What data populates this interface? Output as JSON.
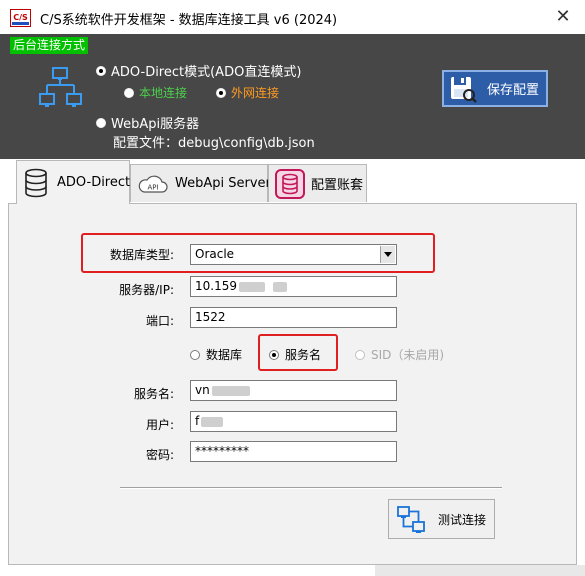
{
  "window": {
    "title": "C/S系统软件开发框架 - 数据库连接工具 v6 (2024)",
    "app_icon_text": "C/S",
    "close_glyph": "✕"
  },
  "header": {
    "mode_label": "后台连接方式",
    "ado_direct_label": "ADO-Direct模式(ADO直连模式)",
    "ado_direct_checked": true,
    "local_label": "本地连接",
    "local_checked": false,
    "external_label": "外网连接",
    "external_checked": true,
    "webapi_label": "WebApi服务器",
    "webapi_checked": false,
    "config_file": "配置文件：debug\\config\\db.json",
    "save_button": "保存配置",
    "colors": {
      "panel": "#474747",
      "mode_label_bg": "#00c000",
      "local": "#4cd04c",
      "external": "#ff9a20",
      "save_bg": "#2e5da8"
    }
  },
  "tabs": [
    {
      "label": "ADO-Direct",
      "active": true,
      "icon": "database-icon"
    },
    {
      "label": "WebApi Server",
      "active": false,
      "icon": "cloud-api-icon"
    },
    {
      "label": "配置账套",
      "active": false,
      "icon": "database-pink-icon"
    }
  ],
  "form": {
    "db_type_label": "数据库类型:",
    "db_type_value": "Oracle",
    "server_label": "服务器/IP:",
    "server_value": "10.159",
    "port_label": "端口:",
    "port_value": "1522",
    "mode_database_label": "数据库",
    "mode_database_checked": false,
    "mode_service_label": "服务名",
    "mode_service_checked": true,
    "mode_sid_label": "SID（未启用)",
    "mode_sid_enabled": false,
    "service_name_label": "服务名:",
    "service_name_value": "vn",
    "user_label": "用户:",
    "user_value": "f",
    "password_label": "密码:",
    "password_value": "*********",
    "test_button": "测试连接"
  }
}
